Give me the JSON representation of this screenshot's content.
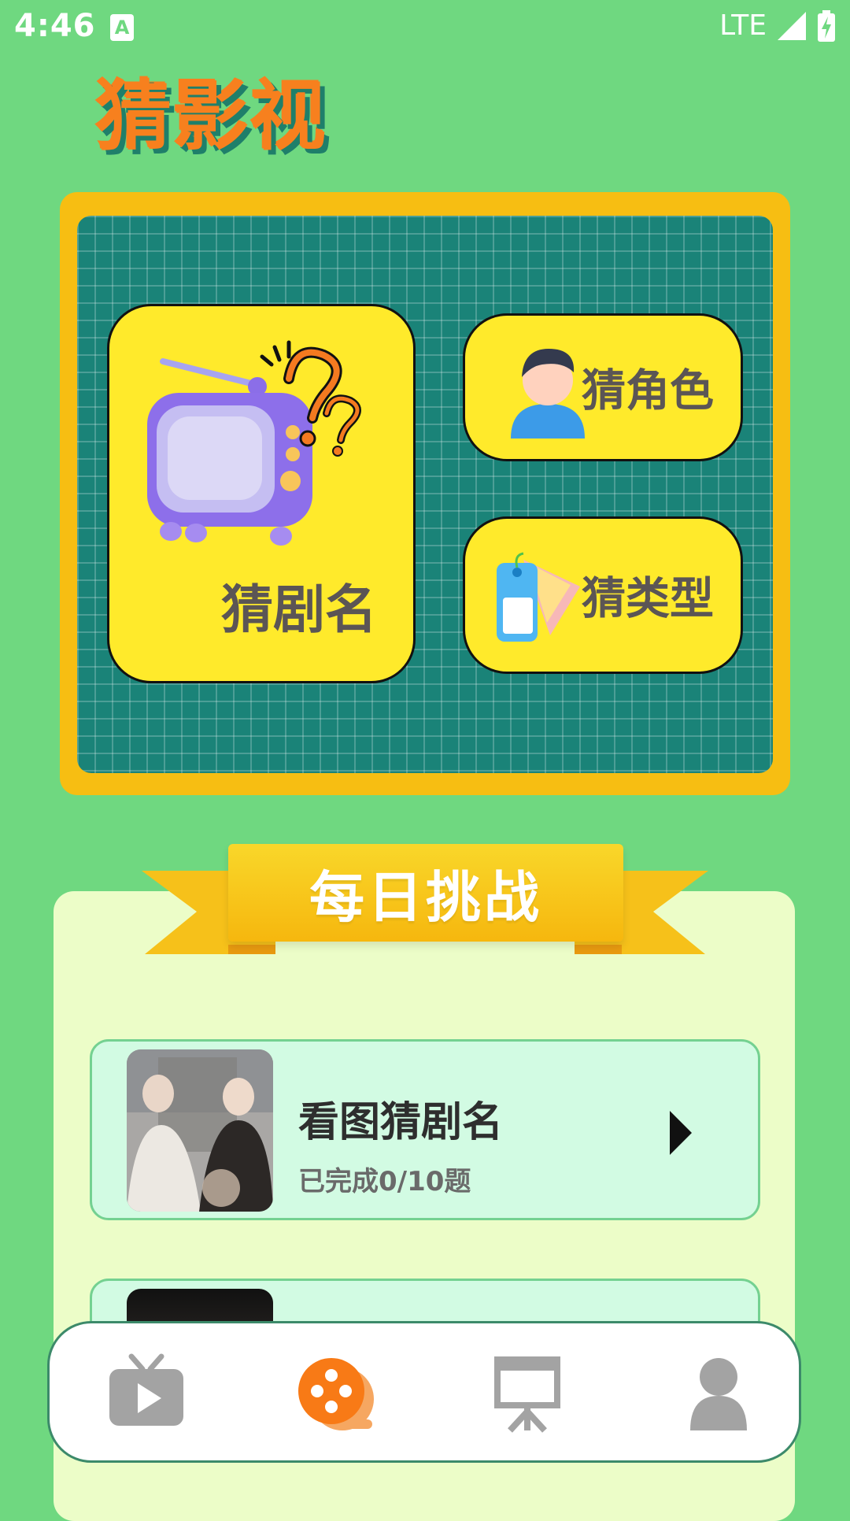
{
  "status_bar": {
    "time": "4:46",
    "network": "LTE",
    "notification_glyph": "A"
  },
  "app": {
    "title": "猜影视"
  },
  "modes": {
    "guess_drama": {
      "label": "猜剧名",
      "icon": "tv-question-icon"
    },
    "guess_role": {
      "label": "猜角色",
      "icon": "person-icon"
    },
    "guess_type": {
      "label": "猜类型",
      "icon": "tag-icon"
    }
  },
  "daily_challenge": {
    "title": "每日挑战",
    "items": [
      {
        "title": "看图猜剧名",
        "progress": "已完成0/10题",
        "icon": "play-arrow-icon"
      },
      {
        "title": "",
        "progress": ""
      }
    ]
  },
  "bottom_nav": {
    "items": [
      {
        "name": "tv-play",
        "icon": "tv-play-icon",
        "active": false
      },
      {
        "name": "game",
        "icon": "film-reel-icon",
        "active": true
      },
      {
        "name": "presentation",
        "icon": "presentation-icon",
        "active": false
      },
      {
        "name": "profile",
        "icon": "user-icon",
        "active": false
      }
    ]
  },
  "colors": {
    "background": "#6FD880",
    "accent_orange": "#F7801E",
    "card_yellow": "#FFEA2B",
    "frame_yellow": "#F7BE12",
    "board_teal": "#1A8378",
    "inactive_icon": "#A3A3A3"
  }
}
